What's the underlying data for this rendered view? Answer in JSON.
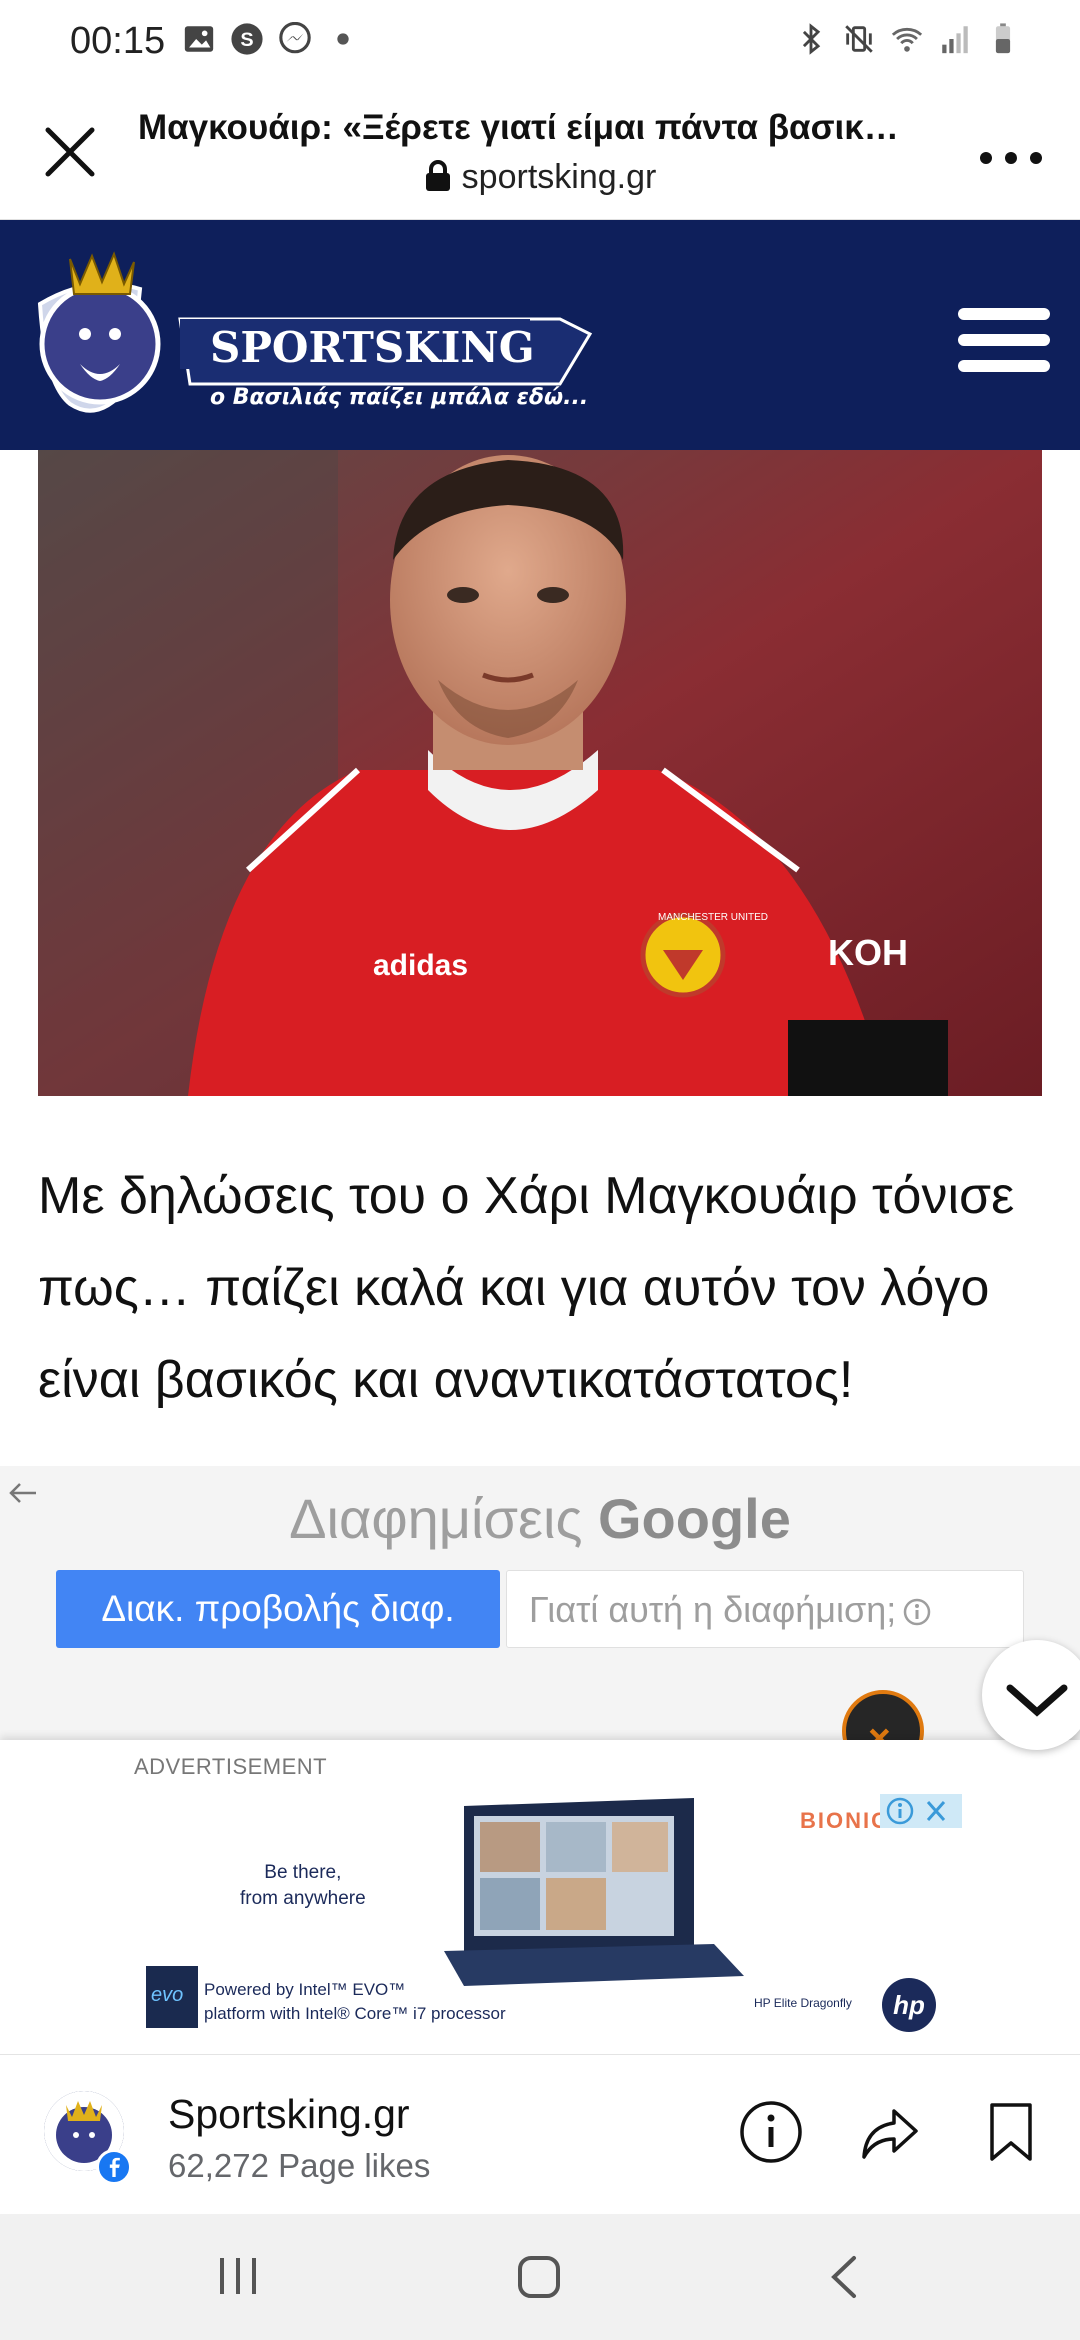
{
  "status_bar": {
    "time": "00:15",
    "left_icons": [
      "image-icon",
      "s-app-icon",
      "messenger-icon",
      "dot-icon"
    ],
    "right_icons": [
      "bluetooth-icon",
      "vibrate-icon",
      "wifi-icon",
      "signal-icon",
      "battery-icon"
    ]
  },
  "browser": {
    "title": "Μαγκουάιρ: «Ξέρετε γιατί είμαι πάντα βασικ…",
    "url": "sportsking.gr"
  },
  "site": {
    "logo_name": "SPORTSKING",
    "logo_tagline": "ο Βασιλιάς παίζει μπάλα εδώ...",
    "brand_color": "#0e1f5b"
  },
  "hero": {
    "jersey_sponsor_left": "adidas",
    "jersey_sponsor_right": "KOH",
    "crest_text": "MANCHESTER UNITED"
  },
  "article": {
    "lead": "Με δηλώσεις του ο Χάρι Μαγκουάιρ τόνισε πως… παίζει καλά και για αυτόν τον λόγο είναι βασικός και αναντικατάστατος!"
  },
  "google_ads": {
    "title_prefix": "Διαφημίσεις",
    "title_brand": "Google",
    "stop_button": "Διακ. προβολής διαφ.",
    "why_button": "Γιατί αυτή η διαφήμιση;",
    "accent_color": "#4285f4"
  },
  "ad": {
    "label": "ADVERTISEMENT",
    "tagline_line1": "Be there,",
    "tagline_line2": "from anywhere",
    "brand": "BIONIC",
    "powered_line1": "Powered by Intel™ EVO™",
    "powered_line2": "platform with Intel® Core™ i7 processor",
    "evo_badge": "evo",
    "model": "HP Elite Dragonfly",
    "hp_logo": "hp"
  },
  "facebook": {
    "page_name": "Sportsking.gr",
    "likes": "62,272 Page likes",
    "accent_color": "#1877f2"
  }
}
